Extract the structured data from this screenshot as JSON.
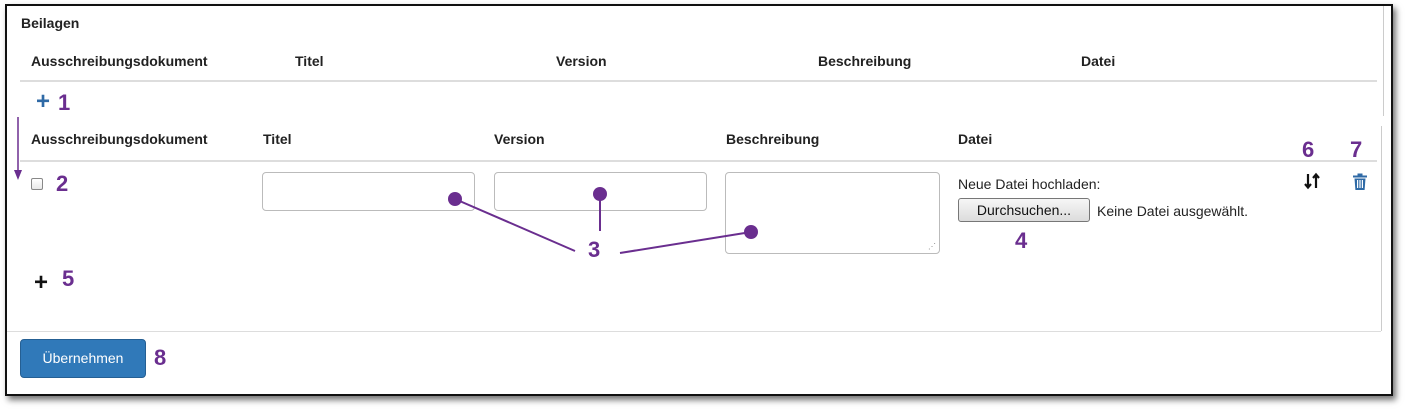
{
  "section": {
    "title": "Beilagen"
  },
  "headers_top": [
    "Ausschreibungsdokument",
    "Titel",
    "Version",
    "Beschreibung",
    "Datei"
  ],
  "headers_row": [
    "Ausschreibungsdokument",
    "Titel",
    "Version",
    "Beschreibung",
    "Datei"
  ],
  "file": {
    "upload_label": "Neue Datei hochladen:",
    "browse_button": "Durchsuchen...",
    "no_file_text": "Keine Datei ausgewählt."
  },
  "actions": {
    "add_symbol": "+",
    "submit_label": "Übernehmen",
    "sort_icon": "sort-icon",
    "delete_icon": "trash-icon"
  },
  "callouts": {
    "c1": "1",
    "c2": "2",
    "c3": "3",
    "c4": "4",
    "c5": "5",
    "c6": "6",
    "c7": "7",
    "c8": "8"
  },
  "colors": {
    "callout": "#6a2e8f",
    "primary_button": "#3079b9",
    "add_icon_blue": "#2f6aa6"
  }
}
